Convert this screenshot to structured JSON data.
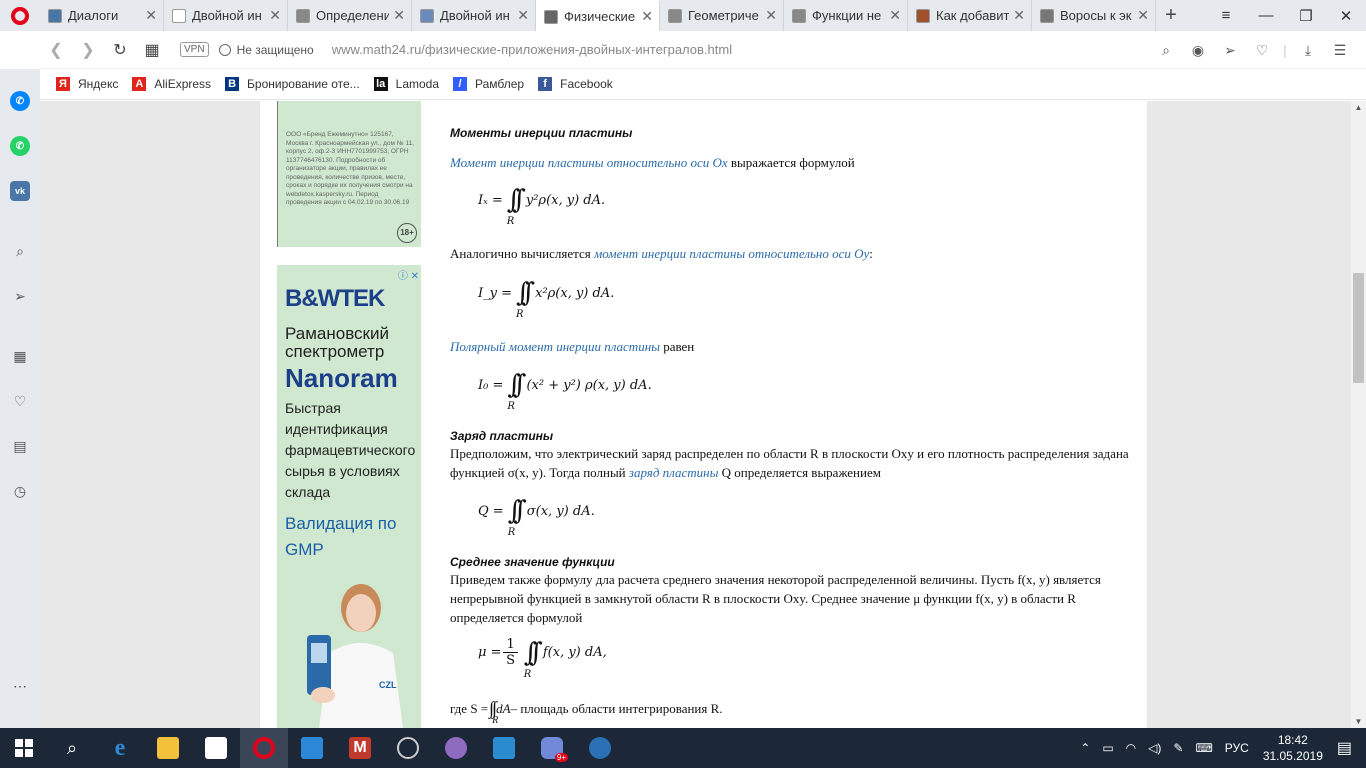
{
  "tabs": [
    {
      "label": "Диалоги",
      "color": "#4a76a8",
      "active": false
    },
    {
      "label": "Двойной ин",
      "color": "#ffffff",
      "active": false
    },
    {
      "label": "Определени",
      "color": "#888888",
      "active": false
    },
    {
      "label": "Двойной ин",
      "color": "#6a8ab8",
      "active": false
    },
    {
      "label": "Физические",
      "color": "#666666",
      "active": true
    },
    {
      "label": "Геометриче",
      "color": "#888888",
      "active": false
    },
    {
      "label": "Функции не",
      "color": "#888888",
      "active": false
    },
    {
      "label": "Как добавит",
      "color": "#a0522d",
      "active": false
    },
    {
      "label": "Воросы к эк",
      "color": "#777777",
      "active": false
    }
  ],
  "address": {
    "vpn": "VPN",
    "security": "Не защищено",
    "url": "www.math24.ru/физические-приложения-двойных-интегралов.html"
  },
  "bookmarks": [
    {
      "label": "Яндекс",
      "icon": "Я",
      "color": "#e0261b"
    },
    {
      "label": "AliExpress",
      "icon": "A",
      "color": "#e0261b"
    },
    {
      "label": "Бронирование оте...",
      "icon": "B",
      "color": "#003580"
    },
    {
      "label": "Lamoda",
      "icon": "la",
      "color": "#111111"
    },
    {
      "label": "Рамблер",
      "icon": "/",
      "color": "#315efb"
    },
    {
      "label": "Facebook",
      "icon": "f",
      "color": "#3b5998"
    }
  ],
  "ad_top": {
    "text": "ООО «Бренд Ежеминутно» 125167, Москва г. Красноармейская ул., дом № 11, корпус 2, оф.2-3 ИНН7701999753, ОГРН 1137746476130. Подробности об организаторе акции, правилах ее проведения, количестве призов, месте, сроках и порядке их получения смотри на webdetox.kaspersky.ru. Период проведения акции с 04.02.19 по 30.06.19",
    "age": "18+"
  },
  "ad_main": {
    "adchoice": "ⓘ ✕",
    "brand": "B&WTEK",
    "title": "Рамановский спектрометр",
    "product": "Nanoram",
    "desc": "Быстрая идентификация фармацевтического сырья в условиях склада",
    "valid": "Валидация по GMP"
  },
  "article": {
    "h_inertia": "Моменты инерции пластины",
    "p1_link": "Момент инерции пластины относительно оси Ox",
    "p1_rest": " выражается формулой",
    "f1": "Iₓ =",
    "f1_body": "y²ρ(x, y) dA.",
    "p2_start": "Аналогично вычисляется ",
    "p2_link": "момент инерции пластины относительно оси Oy",
    "p2_end": ":",
    "f2": "I_y =",
    "f2_body": "x²ρ(x, y) dA.",
    "p3_link": "Полярный момент инерции пластины",
    "p3_rest": " равен",
    "f3": "I₀ =",
    "f3_body": "(x² + y²) ρ(x, y) dA.",
    "h_charge": "Заряд пластины",
    "p4_a": "Предположим, что электрический заряд распределен по области R в плоскости Oxy и его плотность распределения задана функцией σ(x, y). Тогда полный ",
    "p4_link": "заряд пластины",
    "p4_b": " Q определяется выражением",
    "f4": "Q =",
    "f4_body": "σ(x, y) dA.",
    "h_mean": "Среднее значение функции",
    "p5": "Приведем также формулу дла расчета среднего значения некоторой распределенной величины. Пусть f(x, y) является непрерывной функцией в замкнутой области R в плоскости Oxy. Среднее значение μ функции f(x, y) в области R определяется формулой",
    "f5": "μ =",
    "f5_num": "1",
    "f5_den": "S",
    "f5_body": "f(x, y) dA,",
    "p6_a": "где S =",
    "p6_b": "dA",
    "p6_c": " – площадь области интегрирования R.",
    "region": "R"
  },
  "taskbar": {
    "lang": "РУС",
    "time": "18:42",
    "date": "31.05.2019",
    "badge": "9+"
  }
}
